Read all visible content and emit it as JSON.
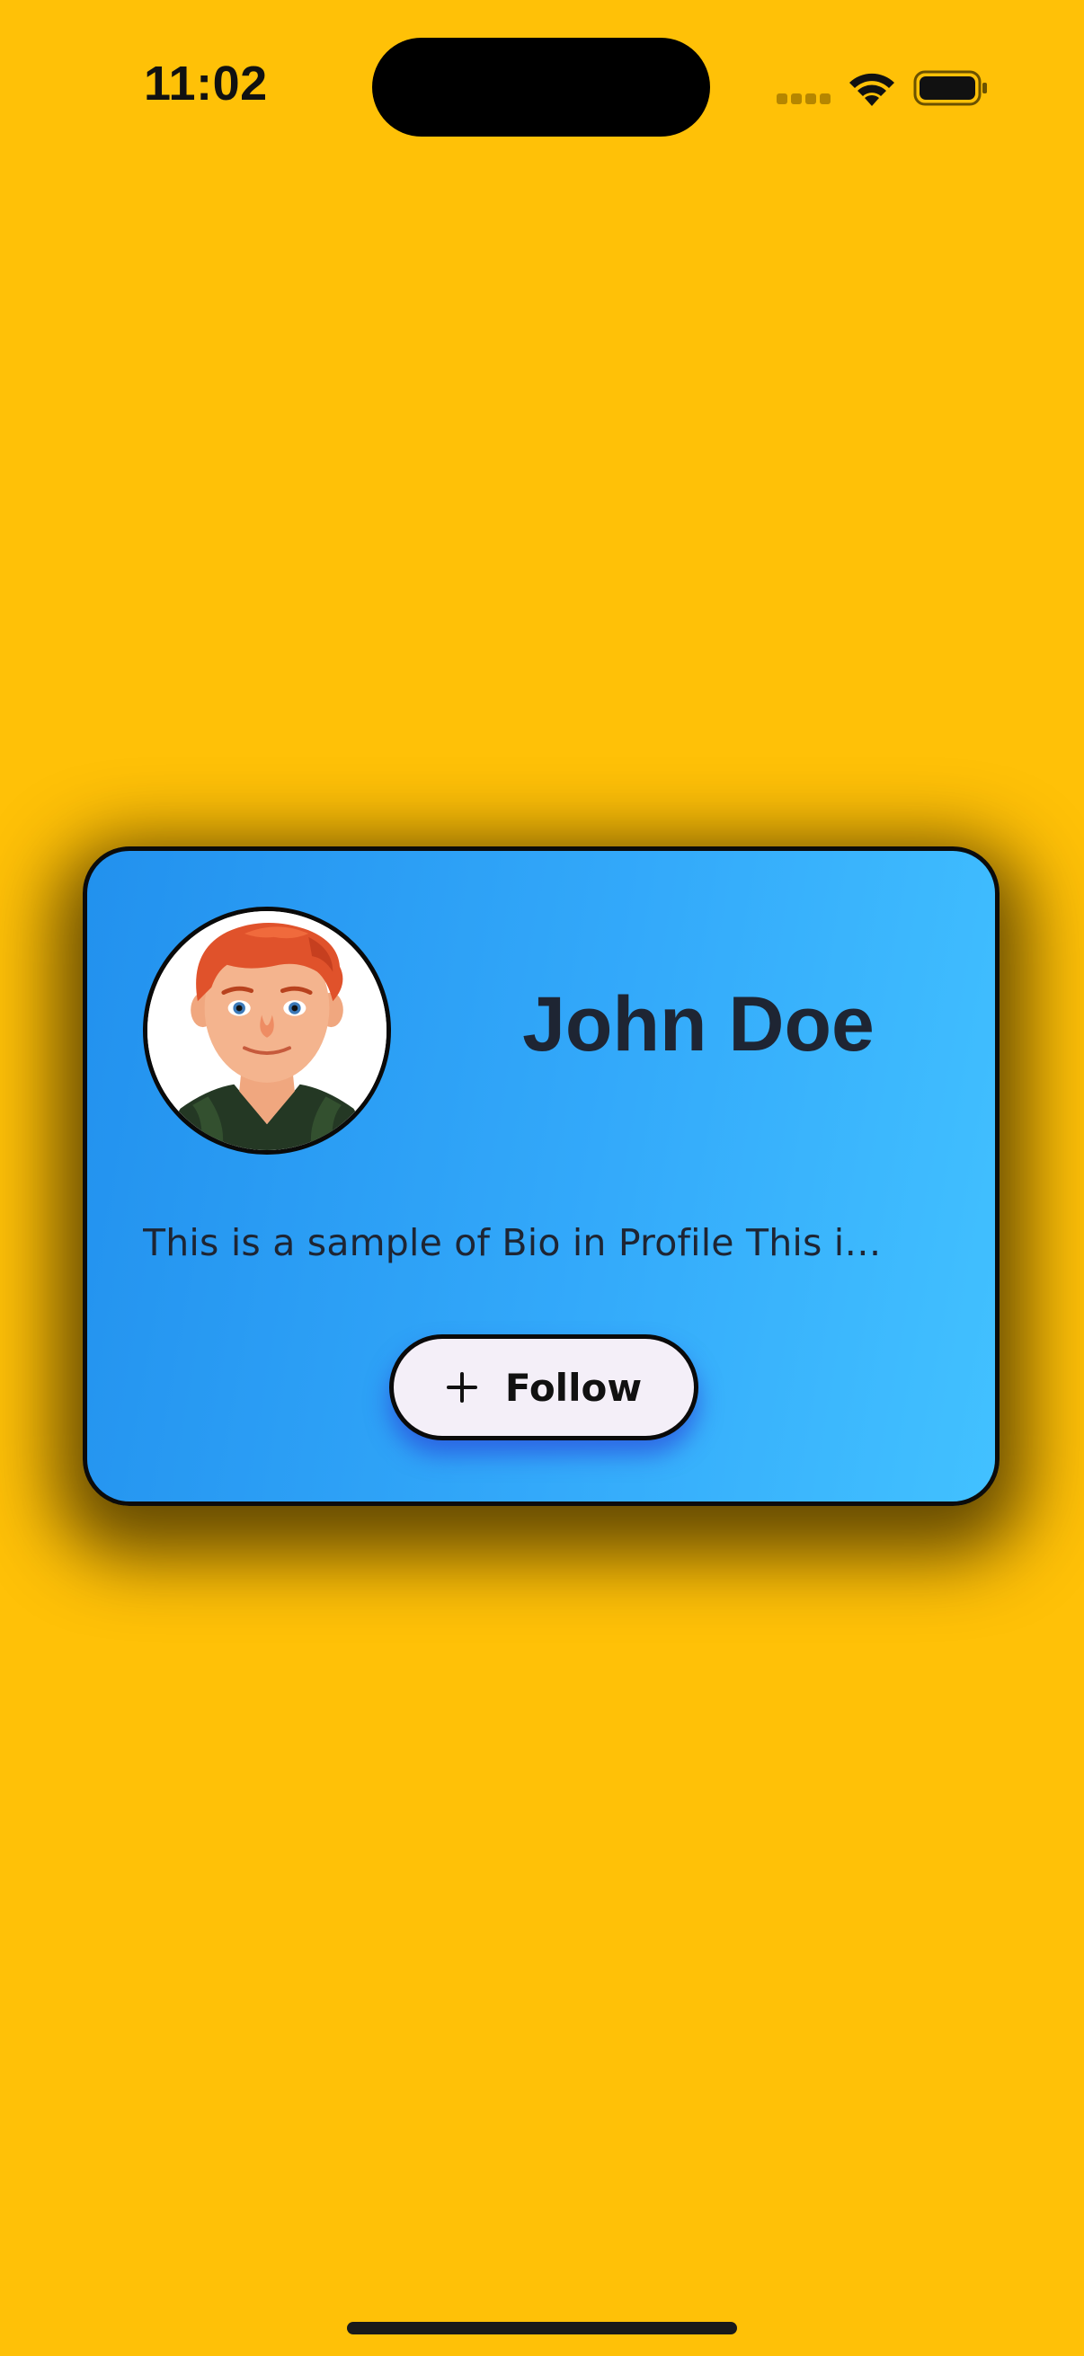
{
  "status_bar": {
    "time": "11:02",
    "icons": [
      "cellular-signal-icon",
      "wifi-icon",
      "battery-icon"
    ]
  },
  "profile_card": {
    "name": "John Doe",
    "bio": "This is a sample of Bio in Profile  This i…",
    "follow_button": {
      "label": "Follow",
      "icon": "plus-icon"
    },
    "avatar_icon": "avatar-illustration"
  },
  "colors": {
    "background": "#FFC107",
    "card_gradient_start": "#2291EE",
    "card_gradient_end": "#42C1FF",
    "text_dark": "#1E2533",
    "button_background": "#F4EFF8"
  }
}
